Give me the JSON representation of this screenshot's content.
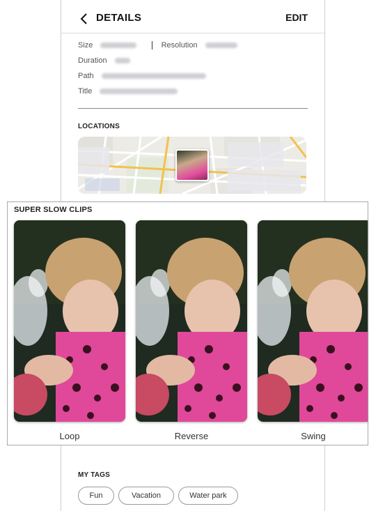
{
  "header": {
    "title": "DETAILS",
    "edit_label": "EDIT"
  },
  "info": {
    "size_label": "Size",
    "resolution_label": "Resolution",
    "duration_label": "Duration",
    "path_label": "Path",
    "title_label": "Title"
  },
  "locations": {
    "label": "LOCATIONS"
  },
  "clips": {
    "label": "SUPER SLOW CLIPS",
    "items": [
      {
        "label": "Loop"
      },
      {
        "label": "Reverse"
      },
      {
        "label": "Swing"
      }
    ]
  },
  "tags": {
    "label": "MY TAGS",
    "items": [
      {
        "label": "Fun"
      },
      {
        "label": "Vacation"
      },
      {
        "label": "Water park"
      }
    ]
  },
  "colors": {
    "accent_map_road": "#f2c14e",
    "swimsuit_pink": "#e0489a"
  },
  "icons": {
    "back": "chevron-left-icon"
  }
}
